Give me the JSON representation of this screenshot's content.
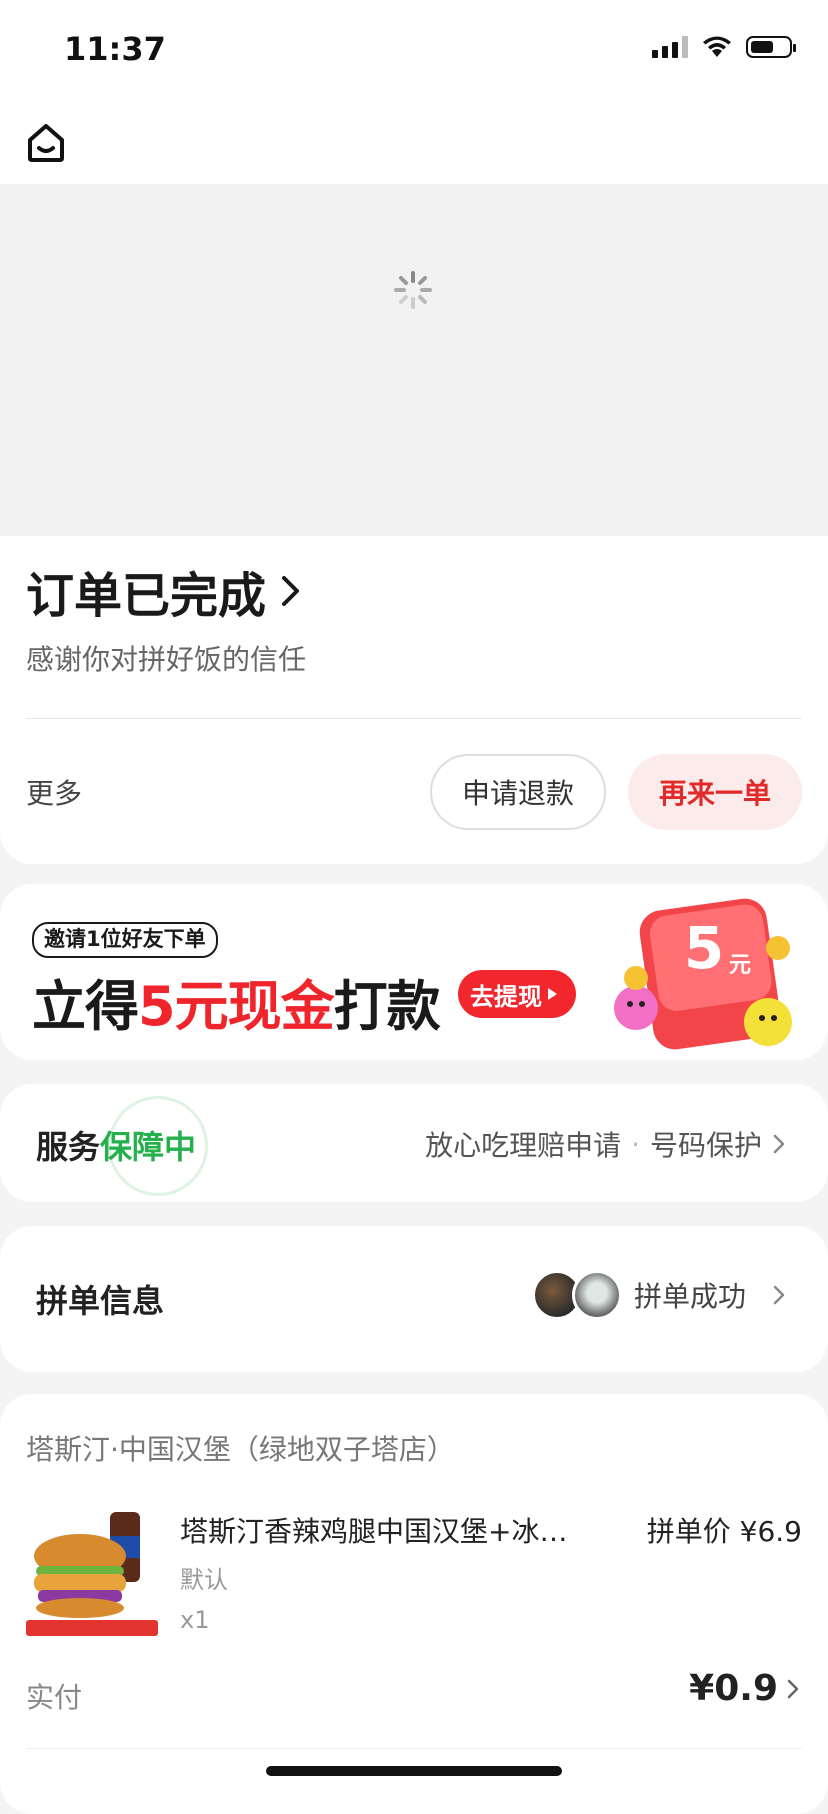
{
  "status_bar": {
    "time": "11:37"
  },
  "order": {
    "title": "订单已完成",
    "thanks": "感谢你对拼好饭的信任",
    "more_label": "更多",
    "refund_label": "申请退款",
    "reorder_label": "再来一单"
  },
  "promo": {
    "invite_text": "邀请1位好友下单",
    "main_prefix": "立得",
    "main_highlight": "5元现金",
    "main_suffix": "打款",
    "withdraw_label": "去提现",
    "coupon_amount": "5",
    "coupon_unit": "元"
  },
  "service": {
    "label_prefix": "服务",
    "label_highlight": "保障中",
    "link1": "放心吃理赔申请",
    "separator": "·",
    "link2": "号码保护"
  },
  "group": {
    "label": "拼单信息",
    "status": "拼单成功"
  },
  "store": {
    "name": "塔斯汀·中国汉堡（绿地双子塔店）",
    "item": {
      "name": "塔斯汀香辣鸡腿中国汉堡+冰…",
      "price": "拼单价 ¥6.9",
      "spec": "默认",
      "qty": "x1"
    },
    "paid_label": "实付",
    "paid_amount": "¥0.9"
  },
  "icons": {
    "home": "home-icon",
    "chevron": "chevron-right-icon",
    "spinner": "loading-spinner-icon"
  },
  "colors": {
    "accent_red": "#f0252c",
    "service_green": "#24b04c",
    "reorder_bg": "#fcebeb"
  }
}
